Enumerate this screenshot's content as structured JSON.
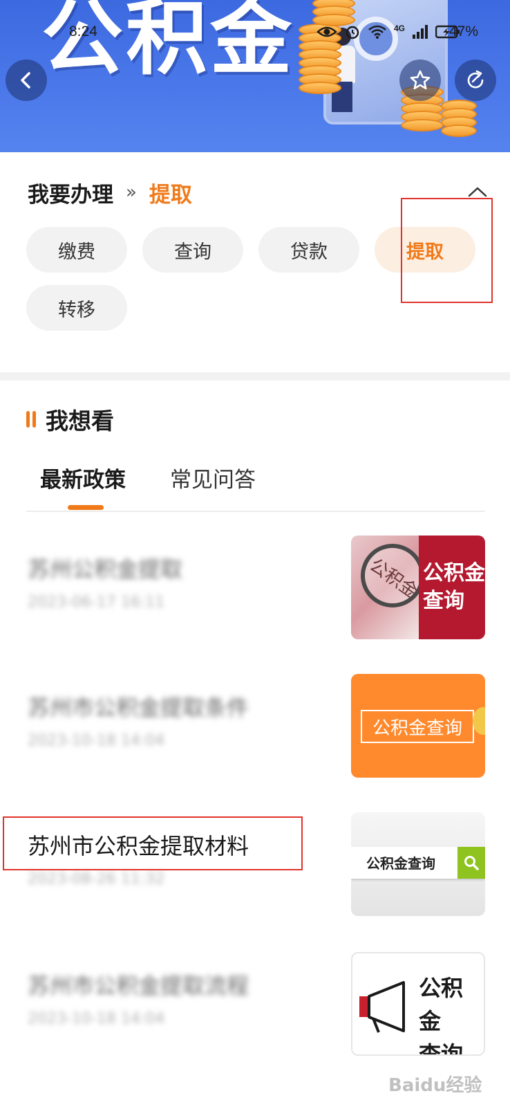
{
  "status_bar": {
    "time": "8:24",
    "network": "4G",
    "battery": "47%"
  },
  "banner": {
    "title": "公积金"
  },
  "handle": {
    "label": "我要办理",
    "separator": "»",
    "current": "提取",
    "options": [
      {
        "label": "缴费",
        "active": false
      },
      {
        "label": "查询",
        "active": false
      },
      {
        "label": "贷款",
        "active": false
      },
      {
        "label": "提取",
        "active": true
      },
      {
        "label": "转移",
        "active": false
      }
    ]
  },
  "want_to_see": {
    "title": "我想看",
    "tabs": [
      {
        "label": "最新政策",
        "active": true
      },
      {
        "label": "常见问答",
        "active": false
      }
    ]
  },
  "articles": [
    {
      "title": "苏州公积金提取",
      "date": "2023-06-17 16:11",
      "blurred": true,
      "thumb": {
        "style": "magnifier",
        "text_line1": "公积金",
        "text_line2": "查询",
        "lens_text": "公积金"
      }
    },
    {
      "title": "苏州市公积金提取条件",
      "date": "2023-10-18 14:04",
      "blurred": true,
      "thumb": {
        "style": "orange-frame",
        "text": "公积金查询"
      }
    },
    {
      "title": "苏州市公积金提取材料",
      "date": "2023-08-26 11:32",
      "blurred": false,
      "thumb": {
        "style": "search-bar",
        "text": "公积金查询"
      }
    },
    {
      "title": "苏州市公积金提取流程",
      "date": "2023-10-18 14:04",
      "blurred": true,
      "thumb": {
        "style": "megaphone",
        "text_line1": "公积金",
        "text_line2": "查询"
      }
    }
  ],
  "watermark": "Baidu经验",
  "colors": {
    "accent": "#f07a1a",
    "banner_blue": "#4b79ea",
    "highlight_box": "#e0322a",
    "chip_bg": "#f2f2f2",
    "chip_active_bg": "#fdeee2"
  }
}
